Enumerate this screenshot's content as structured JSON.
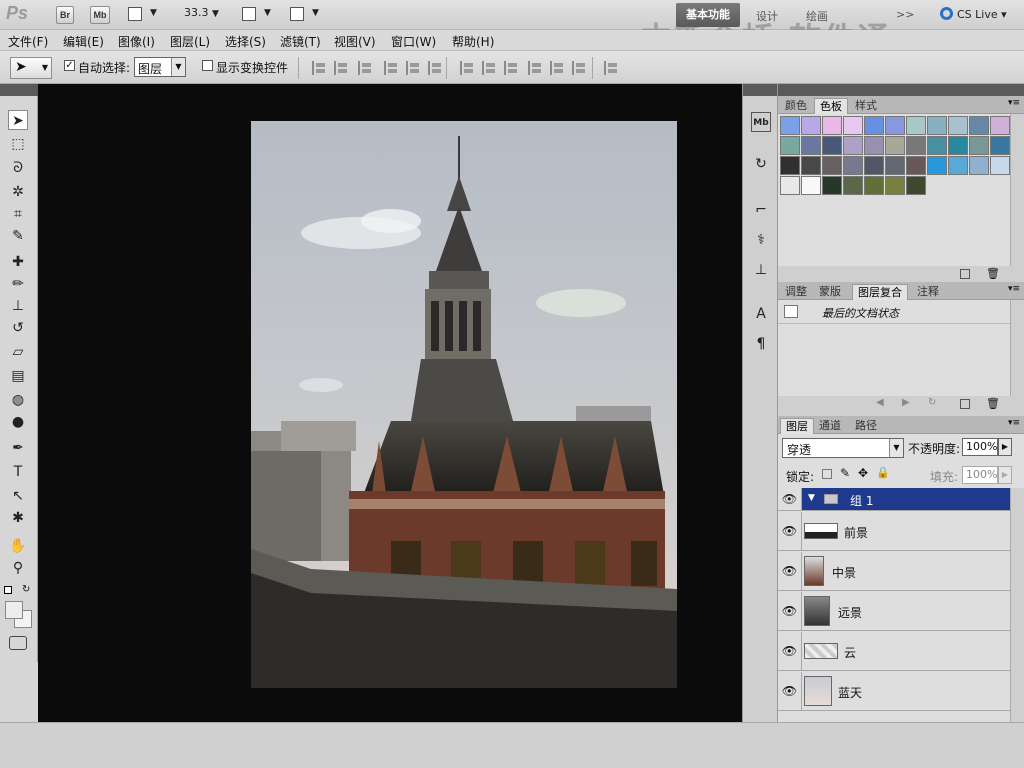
{
  "appbar": {
    "logo": "Ps",
    "bridge_label": "Br",
    "minibridge_label": "Mb",
    "zoom": "33.3",
    "workspace_active": "基本功能",
    "workspace_items": [
      "设计",
      "绘画",
      ">>"
    ],
    "cslive_label": "CS Live",
    "watermark": "中新金桥 软件通"
  },
  "menu": [
    "文件(F)",
    "编辑(E)",
    "图像(I)",
    "图层(L)",
    "选择(S)",
    "滤镜(T)",
    "视图(V)",
    "窗口(W)",
    "帮助(H)"
  ],
  "options": {
    "auto_select_label": "自动选择:",
    "auto_select_checked": "✓",
    "auto_select_value": "图层",
    "show_transform_label": "显示变换控件"
  },
  "swatches_panel": {
    "tabs": [
      "颜色",
      "色板",
      "样式"
    ],
    "active_tab": "色板",
    "colors": [
      "#7aa0e8",
      "#b8a8e8",
      "#e8b8e8",
      "#e8c8f0",
      "#6890e0",
      "#8898e0",
      "#a8c8c8",
      "#88b0c0",
      "#a8c0d0",
      "#6888a8",
      "#d0b0d8",
      "#78a8a0",
      "#6878a0",
      "#485878",
      "#b0a0c8",
      "#9890b0",
      "#a8a898",
      "#787878",
      "#4890a0",
      "#2888a0",
      "#789898",
      "#3878a0",
      "#303030",
      "#484848",
      "#686060",
      "#787890",
      "#505868",
      "#606870",
      "#685858",
      "#2898d8",
      "#58a8d8",
      "#90b0d0",
      "#c8d8e8",
      "#e8e8e8",
      "#f8f8f8",
      "#283828",
      "#586848",
      "#607038",
      "#788040",
      "#404830"
    ]
  },
  "history_panel": {
    "tabs": [
      "调整",
      "蒙版",
      "图层复合",
      "注释"
    ],
    "active_tab": "图层复合",
    "row_label": "最后的文档状态"
  },
  "layers_panel": {
    "tabs": [
      "图层",
      "通道",
      "路径"
    ],
    "active_tab": "图层",
    "blend_mode": "穿透",
    "opacity_label": "不透明度:",
    "opacity_value": "100%",
    "lock_label": "锁定:",
    "fill_label": "填充:",
    "fill_value": "100%",
    "layers": [
      {
        "name": "组 1",
        "type": "group",
        "selected": true
      },
      {
        "name": "前景",
        "type": "layer"
      },
      {
        "name": "中景",
        "type": "layer"
      },
      {
        "name": "远景",
        "type": "layer"
      },
      {
        "name": "云",
        "type": "layer"
      },
      {
        "name": "蓝天",
        "type": "layer"
      }
    ]
  }
}
